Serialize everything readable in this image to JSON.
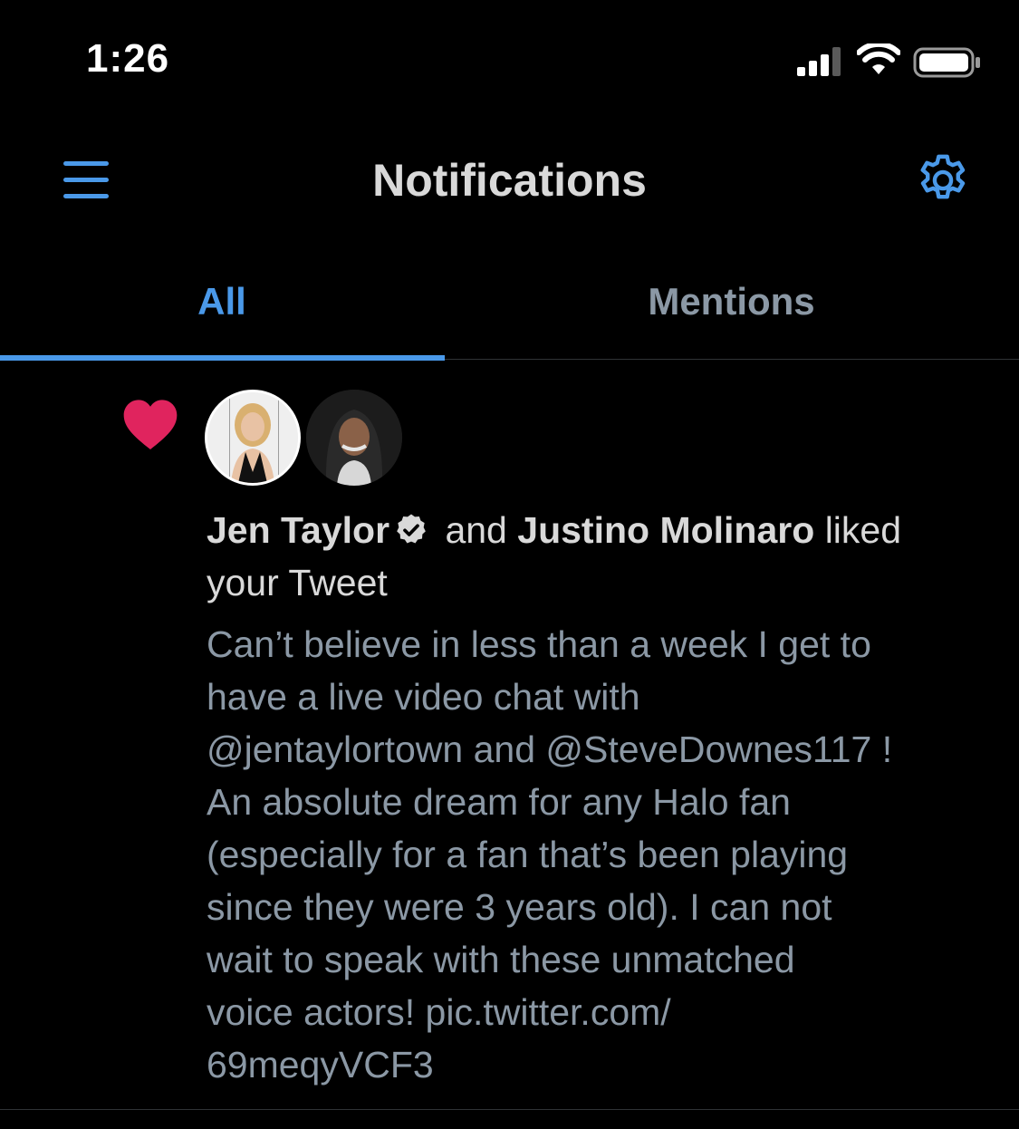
{
  "status_bar": {
    "time": "1:26"
  },
  "header": {
    "title": "Notifications"
  },
  "tabs": [
    {
      "label": "All",
      "active": true
    },
    {
      "label": "Mentions",
      "active": false
    }
  ],
  "notification": {
    "type_icon": "heart-icon",
    "users": [
      {
        "name": "Jen Taylor",
        "verified": true
      },
      {
        "name": "Justino Molinaro",
        "verified": false
      }
    ],
    "connector": "and",
    "action_suffix": "liked",
    "action_object": "your Tweet",
    "tweet_lines": [
      "Can’t believe in less than a week I get to",
      "have a live video chat with",
      "@jentaylortown and @SteveDownes117 !",
      "An absolute dream for any Halo fan",
      "(especially for a fan that’s been playing",
      "since they were 3 years old). I can not",
      "wait to speak with these unmatched",
      "voice actors! pic.twitter.com/",
      "69meqyVCF3"
    ]
  },
  "colors": {
    "accent": "#4A99E9",
    "like": "#E0245E",
    "background": "#000000",
    "secondary_text": "#8B98A5",
    "primary_text": "#D9D9D9"
  }
}
